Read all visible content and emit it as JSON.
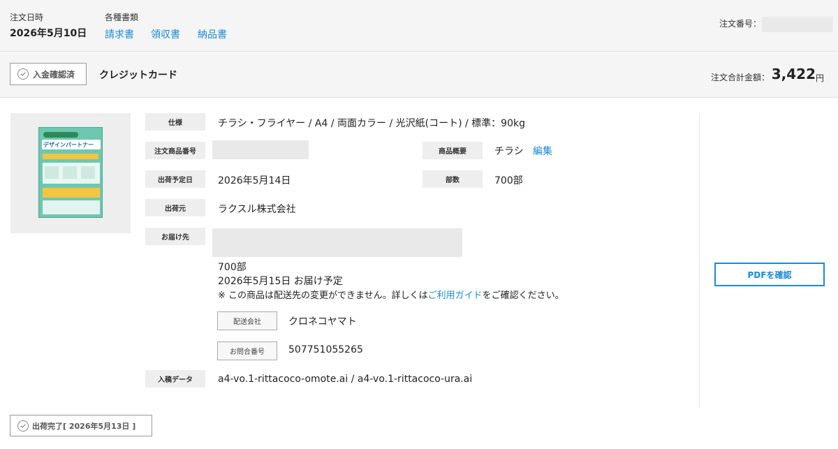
{
  "header": {
    "order_date_label": "注文日時",
    "order_date": "2026年5月10日",
    "documents_label": "各種書類",
    "documents": [
      "請求書",
      "領収書",
      "納品書"
    ],
    "order_number_label": "注文番号："
  },
  "payment": {
    "status_label": "入金確認済",
    "method": "クレジットカード",
    "total_label": "注文合計金額：",
    "total_value": "3,422",
    "total_unit": "円"
  },
  "item": {
    "spec_label": "仕様",
    "spec_value": "チラシ・フライヤー / A4 / 両面カラー / 光沢紙(コート) / 標準：90kg",
    "product_no_label": "注文商品番号",
    "summary_label": "商品概要",
    "summary_value": "チラシ",
    "edit_label": "編集",
    "ship_date_label": "出荷予定日",
    "ship_date_value": "2026年5月14日",
    "copies_label": "部数",
    "copies_value": "700部",
    "shipper_label": "出荷元",
    "shipper_value": "ラクスル株式会社",
    "destination_label": "お届け先",
    "dest_copies": "700部",
    "delivery_date": "2026年5月15日 お届け予定",
    "notice_prefix": "※ この商品は配送先の変更ができません。詳しくは",
    "notice_link": "ご利用ガイド",
    "notice_suffix": "をご確認ください。",
    "carrier_label": "配送会社",
    "carrier_value": "クロネコヤマト",
    "tracking_label": "お問合番号",
    "tracking_value": "507751055265",
    "data_label": "入稿データ",
    "data_value": "a4-vo.1-rittacoco-omote.ai / a4-vo.1-rittacoco-ura.ai",
    "pdf_button": "PDFを確認"
  },
  "shipment_status": "出荷完了[ 2026年5月13日 ]",
  "flyer_thumbnail": {
    "headline": "デザインパートナー",
    "colors": {
      "background": "#6ec7b0",
      "accent": "#f5c542"
    }
  },
  "icons": [
    "check-circle-icon",
    "check-circle-icon"
  ]
}
